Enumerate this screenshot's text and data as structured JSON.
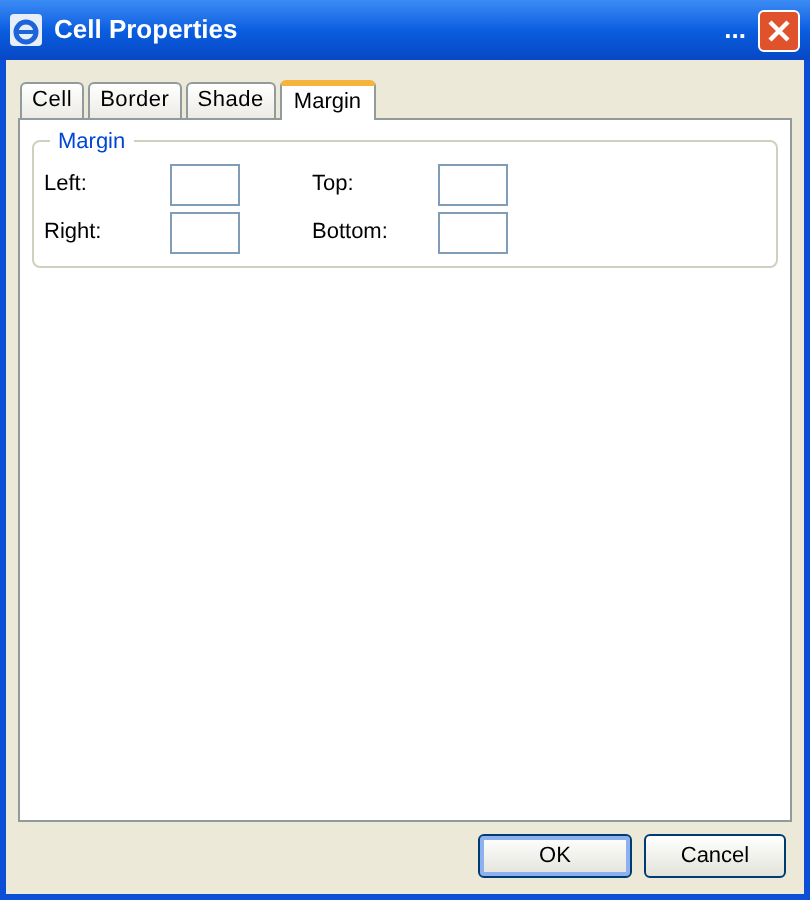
{
  "window": {
    "title": "Cell Properties",
    "title_extra": "..."
  },
  "tabs": [
    {
      "label": "Cell",
      "selected": false
    },
    {
      "label": "Border",
      "selected": false
    },
    {
      "label": "Shade",
      "selected": false
    },
    {
      "label": "Margin",
      "selected": true
    }
  ],
  "group": {
    "title": "Margin",
    "fields": [
      {
        "label": "Left:"
      },
      {
        "label": "Top:"
      },
      {
        "label": "Right:"
      },
      {
        "label": "Bottom:"
      }
    ]
  },
  "buttons": [
    {
      "label": "OK",
      "kind": "default"
    },
    {
      "label": "Cancel",
      "kind": "normal"
    }
  ]
}
